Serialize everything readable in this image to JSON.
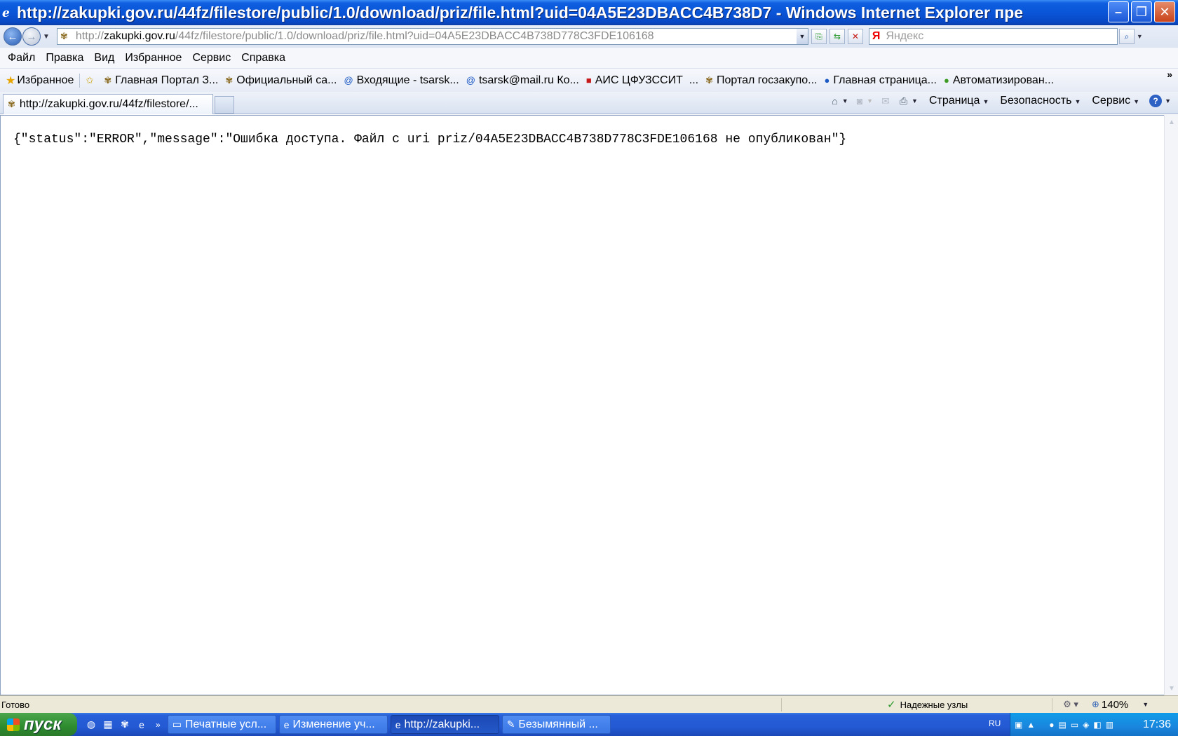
{
  "window": {
    "title": "http://zakupki.gov.ru/44fz/filestore/public/1.0/download/priz/file.html?uid=04A5E23DBACC4B738D7 - Windows Internet Explorer пре"
  },
  "address": {
    "protocol": "http://",
    "host": "zakupki.gov.ru",
    "path": "/44fz/filestore/public/1.0/download/priz/file.html?uid=04A5E23DBACC4B738D778C3FDE106168"
  },
  "search": {
    "placeholder": "Яндекс"
  },
  "menu": [
    "Файл",
    "Правка",
    "Вид",
    "Избранное",
    "Сервис",
    "Справка"
  ],
  "favorites": {
    "label": "Избранное",
    "items": [
      "Главная Портал З...",
      "Официальный са...",
      "Входящие - tsarsk...",
      "tsarsk@mail.ru Ко...",
      "АИС ЦФУЗССИТ",
      "Портал госзакупо...",
      "Главная страница...",
      "Автоматизирован..."
    ],
    "more": "»"
  },
  "tab": {
    "label": "http://zakupki.gov.ru/44fz/filestore/..."
  },
  "commands": {
    "page": "Страница",
    "safety": "Безопасность",
    "tools": "Сервис"
  },
  "content": {
    "raw_text": "{\"status\":\"ERROR\",\"message\":\"Ошибка доступа. Файл с uri priz/04A5E23DBACC4B738D778C3FDE106168 не опубликован\"}"
  },
  "status": {
    "ready": "Готово",
    "zone": "Надежные узлы",
    "zoom": "140%"
  },
  "taskbar": {
    "start": "пуск",
    "tasks": [
      "Печатные усл...",
      "Изменение уч...",
      "http://zakupki...",
      "Безымянный ..."
    ],
    "lang": "RU",
    "clock": "17:36"
  },
  "colors": {
    "titlebar": "#0a55d8",
    "taskbar": "#245ad4",
    "start": "#2e8b2e",
    "tray": "#1a86de"
  }
}
